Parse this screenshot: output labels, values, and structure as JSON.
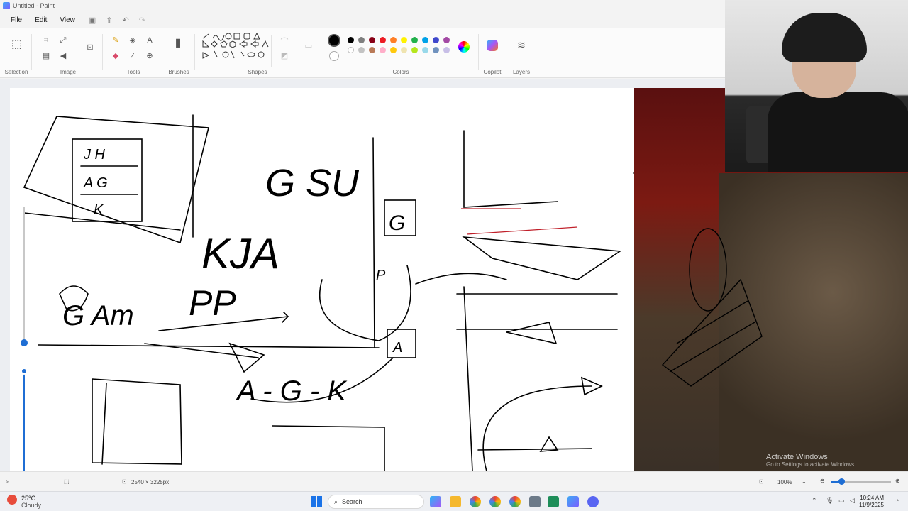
{
  "window": {
    "title": "Untitled - Paint"
  },
  "menu": {
    "file": "File",
    "edit": "Edit",
    "view": "View"
  },
  "ribbon": {
    "groups": {
      "selection": "Selection",
      "image": "Image",
      "tools": "Tools",
      "brushes": "Brushes",
      "shapes": "Shapes",
      "colors": "Colors",
      "copilot": "Copilot",
      "layers": "Layers"
    },
    "colors": {
      "primary": "#000000",
      "row1": [
        "#000000",
        "#7f7f7f",
        "#880015",
        "#ed1c24",
        "#ff7f27",
        "#fff200",
        "#22b14c",
        "#00a2e8",
        "#3f48cc",
        "#a349a4"
      ],
      "row2": [
        "#ffffff",
        "#c3c3c3",
        "#b97a57",
        "#ffaec9",
        "#ffc90e",
        "#efe4b0",
        "#b5e61d",
        "#99d9ea",
        "#7092be",
        "#c8bfe7"
      ]
    }
  },
  "canvas": {
    "sketch_text": [
      "J H",
      "A G",
      "K",
      "G SU",
      "KJA",
      "G",
      "P",
      "A",
      "G Am",
      "PP",
      "A - G - K"
    ],
    "watermark_title": "Activate Windows",
    "watermark_sub": "Go to Settings to activate Windows."
  },
  "status": {
    "canvas_size": "2540 × 3225px",
    "zoom": "100%"
  },
  "taskbar": {
    "weather_temp": "25°C",
    "weather_desc": "Cloudy",
    "search_placeholder": "Search",
    "time": "10:24 AM",
    "date": "11/9/2025"
  }
}
